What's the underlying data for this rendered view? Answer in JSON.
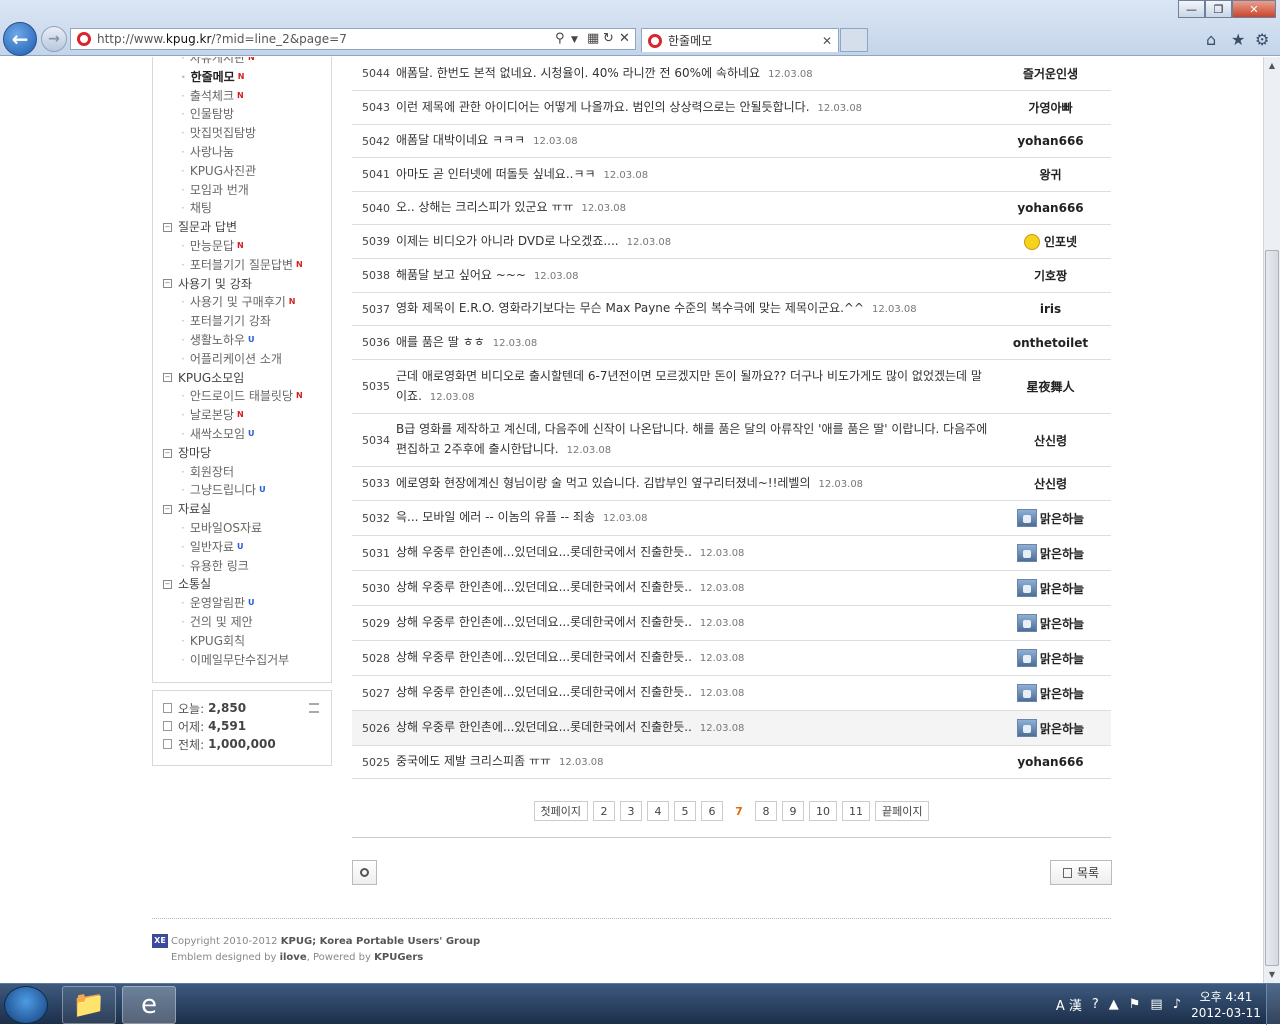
{
  "browser": {
    "url_prefix": "http://www.",
    "url_host": "kpug.kr",
    "url_path": "/?mid=line_2&page=7",
    "tab_title": "한줄메모"
  },
  "sidebar": {
    "items": [
      {
        "type": "sub",
        "label": "자유게시판",
        "badge": "N"
      },
      {
        "type": "sub",
        "label": "한줄메모",
        "badge": "N",
        "current": true
      },
      {
        "type": "sub",
        "label": "출석체크",
        "badge": "N"
      },
      {
        "type": "sub",
        "label": "인물탐방",
        "badge": ""
      },
      {
        "type": "sub",
        "label": "맛집멋집탐방",
        "badge": ""
      },
      {
        "type": "sub",
        "label": "사랑나눔",
        "badge": ""
      },
      {
        "type": "sub",
        "label": "KPUG사진관",
        "badge": ""
      },
      {
        "type": "sub",
        "label": "모임과 번개",
        "badge": ""
      },
      {
        "type": "sub",
        "label": "채팅",
        "badge": ""
      },
      {
        "type": "cat",
        "label": "질문과 답변"
      },
      {
        "type": "sub",
        "label": "만능문답",
        "badge": "N"
      },
      {
        "type": "sub",
        "label": "포터블기기 질문답변",
        "badge": "N"
      },
      {
        "type": "cat",
        "label": "사용기 및 강좌"
      },
      {
        "type": "sub",
        "label": "사용기 및 구매후기",
        "badge": "N"
      },
      {
        "type": "sub",
        "label": "포터블기기 강좌",
        "badge": ""
      },
      {
        "type": "sub",
        "label": "생활노하우",
        "badge": "U"
      },
      {
        "type": "sub",
        "label": "어플리케이션 소개",
        "badge": ""
      },
      {
        "type": "cat",
        "label": "KPUG소모임"
      },
      {
        "type": "sub",
        "label": "안드로이드 태블릿당",
        "badge": "N"
      },
      {
        "type": "sub",
        "label": "날로본당",
        "badge": "N"
      },
      {
        "type": "sub",
        "label": "새싹소모임",
        "badge": "U"
      },
      {
        "type": "cat",
        "label": "장마당"
      },
      {
        "type": "sub",
        "label": "회원장터",
        "badge": ""
      },
      {
        "type": "sub",
        "label": "그냥드립니다",
        "badge": "U"
      },
      {
        "type": "cat",
        "label": "자료실"
      },
      {
        "type": "sub",
        "label": "모바일OS자료",
        "badge": ""
      },
      {
        "type": "sub",
        "label": "일반자료",
        "badge": "U"
      },
      {
        "type": "sub",
        "label": "유용한 링크",
        "badge": ""
      },
      {
        "type": "cat",
        "label": "소통실"
      },
      {
        "type": "sub",
        "label": "운영알림판",
        "badge": "U"
      },
      {
        "type": "sub",
        "label": "건의 및 제안",
        "badge": ""
      },
      {
        "type": "sub",
        "label": "KPUG회칙",
        "badge": ""
      },
      {
        "type": "sub",
        "label": "이메일무단수집거부",
        "badge": ""
      }
    ]
  },
  "counter": {
    "today_label": "오늘:",
    "today": "2,850",
    "yesterday_label": "어제:",
    "yesterday": "4,591",
    "total_label": "전체:",
    "total": "1,000,000"
  },
  "board": {
    "rows": [
      {
        "no": "5044",
        "msg": "애폼달. 한번도 본적 없네요. 시청율이. 40% 라니깐 전 60%에 속하네요",
        "date": "12.03.08",
        "author": "즐거운인생",
        "avatar": ""
      },
      {
        "no": "5043",
        "msg": "이런 제목에 관한 아이디어는 어떻게 나올까요. 범인의 상상력으로는 안될듯합니다.",
        "date": "12.03.08",
        "author": "가영아빠",
        "avatar": ""
      },
      {
        "no": "5042",
        "msg": "애폼달 대박이네요 ㅋㅋㅋ",
        "date": "12.03.08",
        "author": "yohan666",
        "avatar": ""
      },
      {
        "no": "5041",
        "msg": "아마도 곧 인터넷에 떠돌듯 싶네요..ㅋㅋ",
        "date": "12.03.08",
        "author": "왕귀",
        "avatar": ""
      },
      {
        "no": "5040",
        "msg": "오.. 상해는 크리스피가 있군요 ㅠㅠ",
        "date": "12.03.08",
        "author": "yohan666",
        "avatar": ""
      },
      {
        "no": "5039",
        "msg": "이제는 비디오가 아니라 DVD로 나오겠죠....",
        "date": "12.03.08",
        "author": "인포넷",
        "avatar": "emo"
      },
      {
        "no": "5038",
        "msg": "해품달 보고 싶어요 ~~~",
        "date": "12.03.08",
        "author": "기호짱",
        "avatar": ""
      },
      {
        "no": "5037",
        "msg": "영화 제목이 E.R.O. 영화라기보다는 무슨 Max Payne 수준의 복수극에 맞는 제목이군요.^^",
        "date": "12.03.08",
        "author": "iris",
        "avatar": ""
      },
      {
        "no": "5036",
        "msg": "애를 품은 딸 ㅎㅎ",
        "date": "12.03.08",
        "author": "onthetoilet",
        "avatar": ""
      },
      {
        "no": "5035",
        "msg": "근데 애로영화면 비디오로 출시할텐데 6-7년전이면 모르겠지만 돈이 될까요?? 더구나 비도가게도 많이 없었겠는데 말이죠.",
        "date": "12.03.08",
        "author": "星夜舞人",
        "avatar": ""
      },
      {
        "no": "5034",
        "msg": "B급 영화를 제작하고 계신데, 다음주에 신작이 나온답니다. 해를 품은 달의 아류작인 '애를 품은 딸' 이랍니다. 다음주에 편집하고 2주후에 출시한답니다.",
        "date": "12.03.08",
        "author": "산신령",
        "avatar": ""
      },
      {
        "no": "5033",
        "msg": "에로영화 현장에계신 형님이랑 술 먹고 있습니다. 김밥부인 옆구리터졌네~!!레벨의",
        "date": "12.03.08",
        "author": "산신령",
        "avatar": ""
      },
      {
        "no": "5032",
        "msg": "윽... 모바일 에러 -- 이놈의 유플 -- 죄송",
        "date": "12.03.08",
        "author": "맑은하늘",
        "avatar": "img"
      },
      {
        "no": "5031",
        "msg": "상해 우중루 한인촌에...있던데요...롯데한국에서 진출한듯..",
        "date": "12.03.08",
        "author": "맑은하늘",
        "avatar": "img"
      },
      {
        "no": "5030",
        "msg": "상해 우중루 한인촌에...있던데요...롯데한국에서 진출한듯..",
        "date": "12.03.08",
        "author": "맑은하늘",
        "avatar": "img"
      },
      {
        "no": "5029",
        "msg": "상해 우중루 한인촌에...있던데요...롯데한국에서 진출한듯..",
        "date": "12.03.08",
        "author": "맑은하늘",
        "avatar": "img"
      },
      {
        "no": "5028",
        "msg": "상해 우중루 한인촌에...있던데요...롯데한국에서 진출한듯..",
        "date": "12.03.08",
        "author": "맑은하늘",
        "avatar": "img"
      },
      {
        "no": "5027",
        "msg": "상해 우중루 한인촌에...있던데요...롯데한국에서 진출한듯..",
        "date": "12.03.08",
        "author": "맑은하늘",
        "avatar": "img"
      },
      {
        "no": "5026",
        "msg": "상해 우중루 한인촌에...있던데요...롯데한국에서 진출한듯..",
        "date": "12.03.08",
        "author": "맑은하늘",
        "avatar": "img",
        "highlight": true
      },
      {
        "no": "5025",
        "msg": "중국에도 제발 크리스피좀 ㅠㅠ",
        "date": "12.03.08",
        "author": "yohan666",
        "avatar": ""
      }
    ]
  },
  "pager": {
    "first": "첫페이지",
    "pages": [
      "2",
      "3",
      "4",
      "5",
      "6",
      "7",
      "8",
      "9",
      "10",
      "11"
    ],
    "current": "7",
    "last": "끝페이지"
  },
  "list_button": "목록",
  "footer": {
    "copyright_prefix": "Copyright 2010-2012",
    "copyright_org": "KPUG; Korea Portable Users' Group",
    "emblem_prefix": "Emblem designed by",
    "emblem_by": "ilove",
    "powered_prefix": ", Powered by",
    "powered_by": "KPUGers"
  },
  "taskbar": {
    "time": "오후 4:41",
    "date": "2012-03-11"
  }
}
